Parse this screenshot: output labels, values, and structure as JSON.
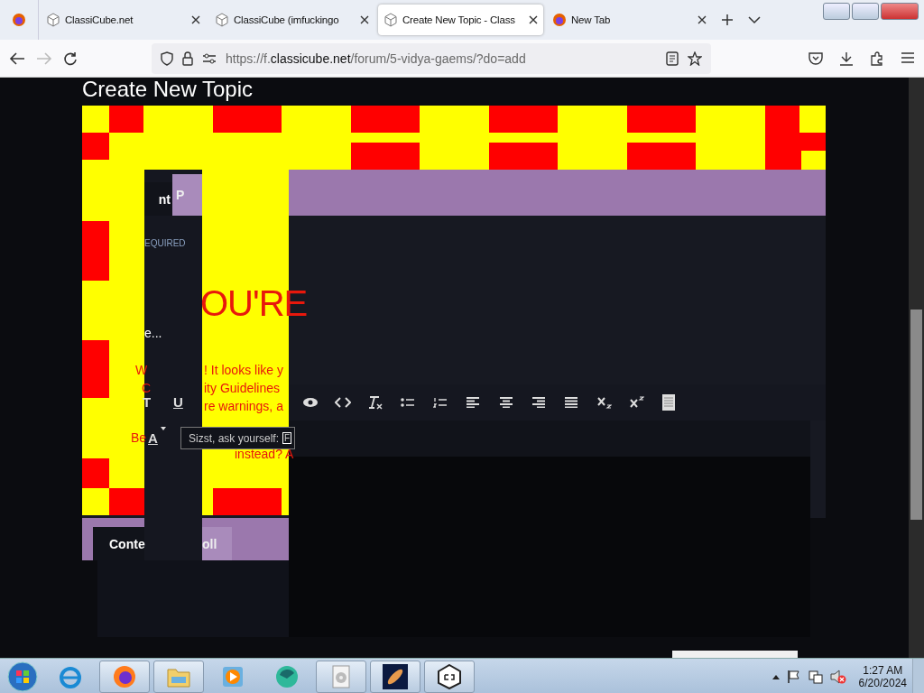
{
  "browser": {
    "tabs": [
      {
        "title": "ClassiCube.net",
        "kind": "site",
        "selected": false
      },
      {
        "title": "ClassiCube (imfuckingo",
        "kind": "site",
        "selected": false
      },
      {
        "title": "Create New Topic - Class",
        "kind": "site",
        "selected": true
      },
      {
        "title": "New Tab",
        "kind": "newtab",
        "selected": false
      }
    ],
    "url": [
      "https://f.",
      "classicube.net",
      "/forum/5-vidya-gaems/?do=add"
    ]
  },
  "page": {
    "heading": "Create New Topic",
    "top_tabs": [
      {
        "label": "nt",
        "selected": true
      },
      {
        "label": "P",
        "selected": false
      }
    ],
    "required_label": "EQUIRED",
    "title_fragment": "e...",
    "big_warning": "OU'RE",
    "warning_lines": [
      "W",
      "! It looks like y",
      "C",
      "ity Guidelines",
      "re warnings, a",
      "Be",
      "instead? A"
    ],
    "format_buttons": [
      "T",
      "U"
    ],
    "font_color_button": "A",
    "style_field": {
      "value": "Sizst, ask yourself:",
      "tail": "F"
    },
    "toolbar": [
      {
        "kind": "preview"
      },
      {
        "kind": "code"
      },
      {
        "kind": "clear-format"
      },
      {
        "kind": "bullet-list"
      },
      {
        "kind": "numbered-list"
      },
      {
        "kind": "align-left"
      },
      {
        "kind": "align-center"
      },
      {
        "kind": "align-right"
      },
      {
        "kind": "justify"
      },
      {
        "kind": "subscript"
      },
      {
        "kind": "superscript"
      },
      {
        "kind": "document"
      }
    ],
    "bottom_tabs": [
      {
        "label": "Conte",
        "selected": true
      },
      {
        "label": "oll",
        "selected": false
      }
    ]
  },
  "taskbar": {
    "apps": [
      {
        "kind": "ie",
        "running": false
      },
      {
        "kind": "firefox",
        "running": true
      },
      {
        "kind": "folder",
        "running": true
      },
      {
        "kind": "media",
        "running": false
      },
      {
        "kind": "orb",
        "running": false
      },
      {
        "kind": "disc",
        "running": true
      },
      {
        "kind": "galaxy",
        "running": true
      },
      {
        "kind": "cube",
        "running": true
      }
    ],
    "volume_muted": true,
    "time": "1:27 AM",
    "date": "6/20/2024"
  }
}
